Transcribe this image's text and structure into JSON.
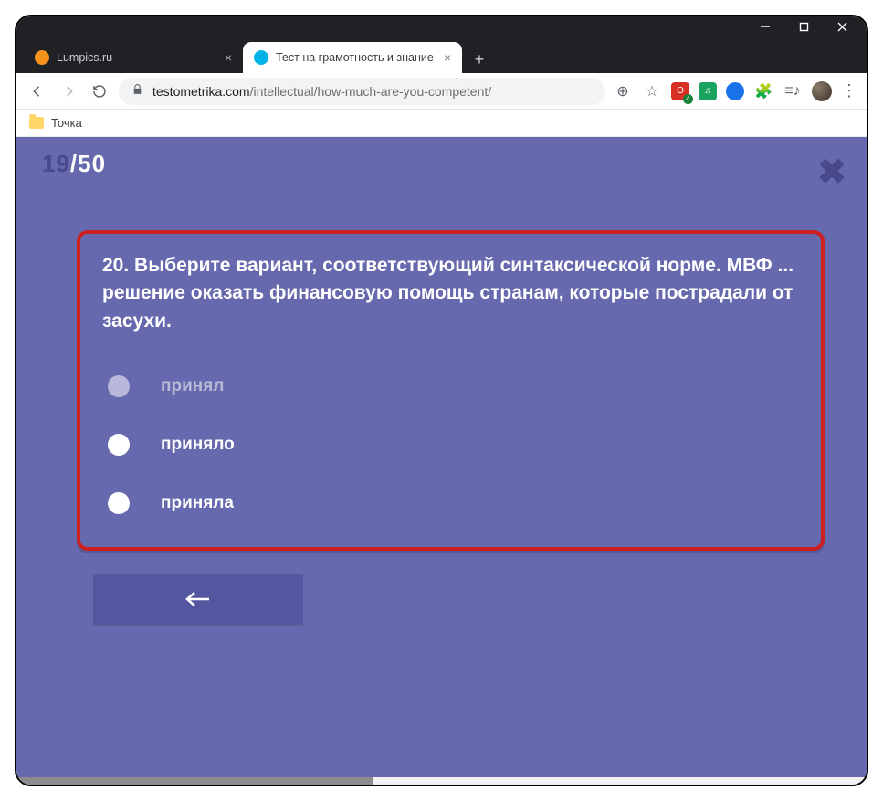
{
  "window": {
    "controls": {
      "min": "–",
      "max": "▢",
      "close": "✕"
    }
  },
  "tabs": [
    {
      "title": "Lumpics.ru",
      "active": false
    },
    {
      "title": "Тест на грамотность и знание р",
      "active": true
    }
  ],
  "newtab_label": "+",
  "address": {
    "host": "testometrika.com",
    "path": "/intellectual/how-much-are-you-competent/"
  },
  "toolbar_icons": {
    "zoom": "⊕",
    "star": "☆",
    "puzzle": "🧩",
    "music": "≡♪",
    "menu": "⋮"
  },
  "bookmarks": [
    {
      "label": "Точка"
    }
  ],
  "quiz": {
    "current": "19",
    "sep": "/",
    "total": "50",
    "close_glyph": "✖",
    "question": "20. Выберите вариант, соответствующий синтаксической норме. МВФ ... решение оказать финансовую помощь странам, которые пострадали от засухи.",
    "options": [
      {
        "label": "принял",
        "hover": true
      },
      {
        "label": "приняло",
        "hover": false
      },
      {
        "label": "приняла",
        "hover": false
      }
    ]
  },
  "scrollbar": {
    "thumb_width_pct": 42
  }
}
